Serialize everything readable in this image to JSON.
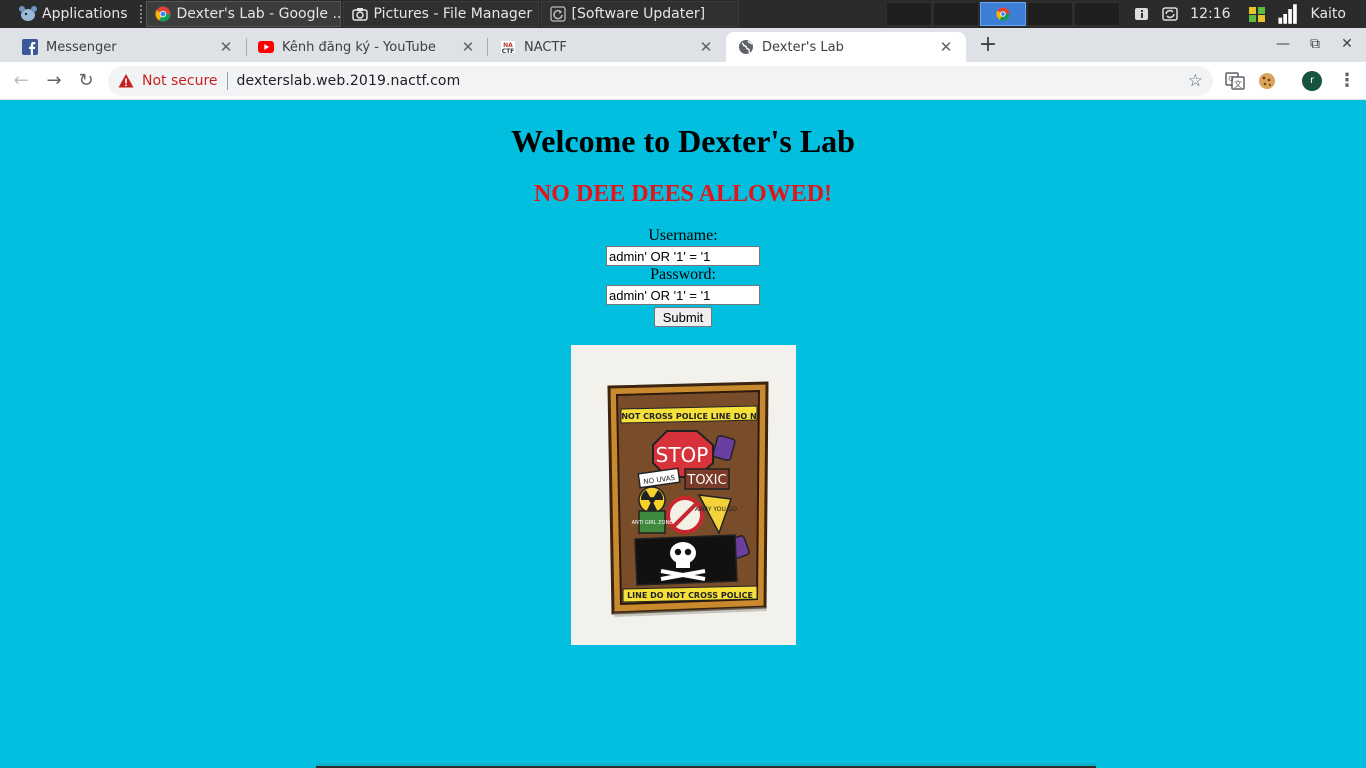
{
  "panel": {
    "apps_label": "Applications",
    "tasks": [
      {
        "label": "Dexter's Lab - Google ...",
        "icon": "chrome-icon"
      },
      {
        "label": "Pictures - File Manager",
        "icon": "camera-icon"
      },
      {
        "label": "[Software Updater]",
        "icon": "updater-icon"
      }
    ],
    "clock": "12:16",
    "user": "Kaito"
  },
  "tabs": [
    {
      "label": "Messenger",
      "icon": "facebook-icon"
    },
    {
      "label": "Kênh đăng ký - YouTube",
      "icon": "youtube-icon"
    },
    {
      "label": "NACTF",
      "icon": "nactf-icon"
    },
    {
      "label": "Dexter's Lab",
      "icon": "globe-icon",
      "active": true
    }
  ],
  "toolbar": {
    "security_label": "Not secure",
    "url": "dexterslab.web.2019.nactf.com",
    "profile_initial": "r"
  },
  "page": {
    "title": "Welcome to Dexter's Lab",
    "subtitle": "NO DEE DEES ALLOWED!",
    "username_label": "Username:",
    "username_value": "admin' OR '1' = '1",
    "password_label": "Password:",
    "password_value": "admin' OR '1' = '1",
    "submit_label": "Submit",
    "image_text": {
      "top_tape": "NOT CROSS POLICE LINE DO N",
      "stop": "STOP",
      "no_uvas": "NO UVAS",
      "toxic": "TOXIC",
      "away": "AWAY YOU GO",
      "anti": "ANTI GIRL ZONE",
      "bottom_tape": "LINE DO NOT CROSS POLICE"
    }
  },
  "colors": {
    "page_bg": "#03bfdf",
    "subtitle": "#e3151b",
    "not_secure": "#c5221f"
  }
}
